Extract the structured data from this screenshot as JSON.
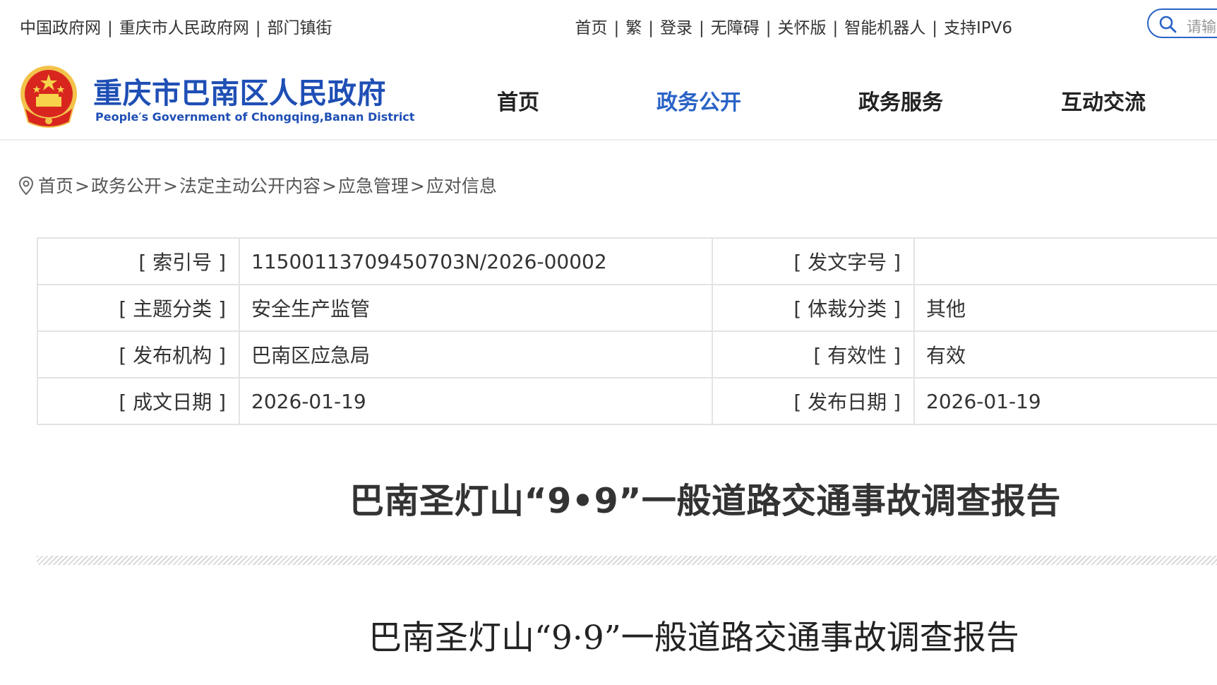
{
  "topbar": {
    "left_links": [
      "中国政府网",
      "重庆市人民政府网",
      "部门镇街"
    ],
    "right_links": [
      "首页",
      "繁",
      "登录",
      "无障碍",
      "关怀版",
      "智能机器人",
      "支持IPV6"
    ],
    "search_placeholder": "请输入"
  },
  "header": {
    "title": "重庆市巴南区人民政府",
    "subtitle": "People′s Government of Chongqing,Banan District",
    "nav": [
      {
        "label": "首页",
        "active": false
      },
      {
        "label": "政务公开",
        "active": true
      },
      {
        "label": "政务服务",
        "active": false
      },
      {
        "label": "互动交流",
        "active": false
      }
    ],
    "accent_color": "#2a63c7",
    "title_color": "#1f4fb5"
  },
  "breadcrumb": [
    "首页",
    "政务公开",
    "法定主动公开内容",
    "应急管理",
    "应对信息"
  ],
  "meta": {
    "rows": [
      {
        "label1": "[ 索引号 ]",
        "value1": "11500113709450703N/2026-00002",
        "label2": "[ 发文字号 ]",
        "value2": ""
      },
      {
        "label1": "[ 主题分类 ]",
        "value1": "安全生产监管",
        "label2": "[ 体裁分类 ]",
        "value2": "其他"
      },
      {
        "label1": "[ 发布机构 ]",
        "value1": "巴南区应急局",
        "label2": "[ 有效性 ]",
        "value2": "有效"
      },
      {
        "label1": "[ 成文日期 ]",
        "value1": "2026-01-19",
        "label2": "[ 发布日期 ]",
        "value2": "2026-01-19"
      }
    ]
  },
  "article": {
    "title": "巴南圣灯山“9•9”一般道路交通事故调查报告",
    "doc_title": "巴南圣灯山“9·9”一般道路交通事故调查报告"
  }
}
